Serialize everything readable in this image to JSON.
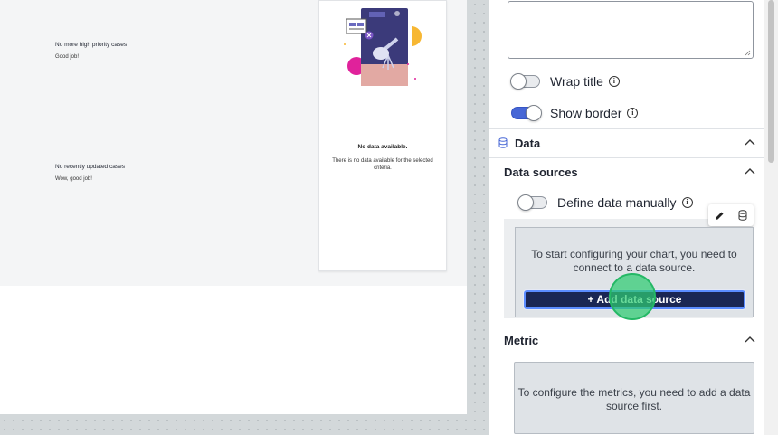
{
  "canvas": {
    "messages": [
      {
        "title": "No more high priority cases",
        "subtitle": "Good job!"
      },
      {
        "title": "No recently updated cases",
        "subtitle": "Wow, good job!"
      }
    ],
    "card": {
      "title": "No data available.",
      "description": "There is no data available for the selected criteria."
    }
  },
  "panel": {
    "wrap_title": {
      "label": "Wrap title",
      "on": false
    },
    "show_border": {
      "label": "Show border",
      "on": true
    },
    "sections": {
      "data": "Data",
      "data_sources": "Data sources",
      "metric": "Metric"
    },
    "define_data_manually": {
      "label": "Define data manually",
      "on": false
    },
    "datasource_message": "To start configuring your chart, you need to connect to a data source.",
    "add_data_source_label": "+ Add data source",
    "metric_message": "To configure the metrics, you need to add a data source first."
  },
  "colors": {
    "accent": "#4767d6",
    "button_bg": "#1a2654",
    "cursor": "#2ecc71"
  },
  "icons": [
    "info-icon",
    "database-icon",
    "chevron-up-icon",
    "pencil-icon",
    "database-icon"
  ]
}
